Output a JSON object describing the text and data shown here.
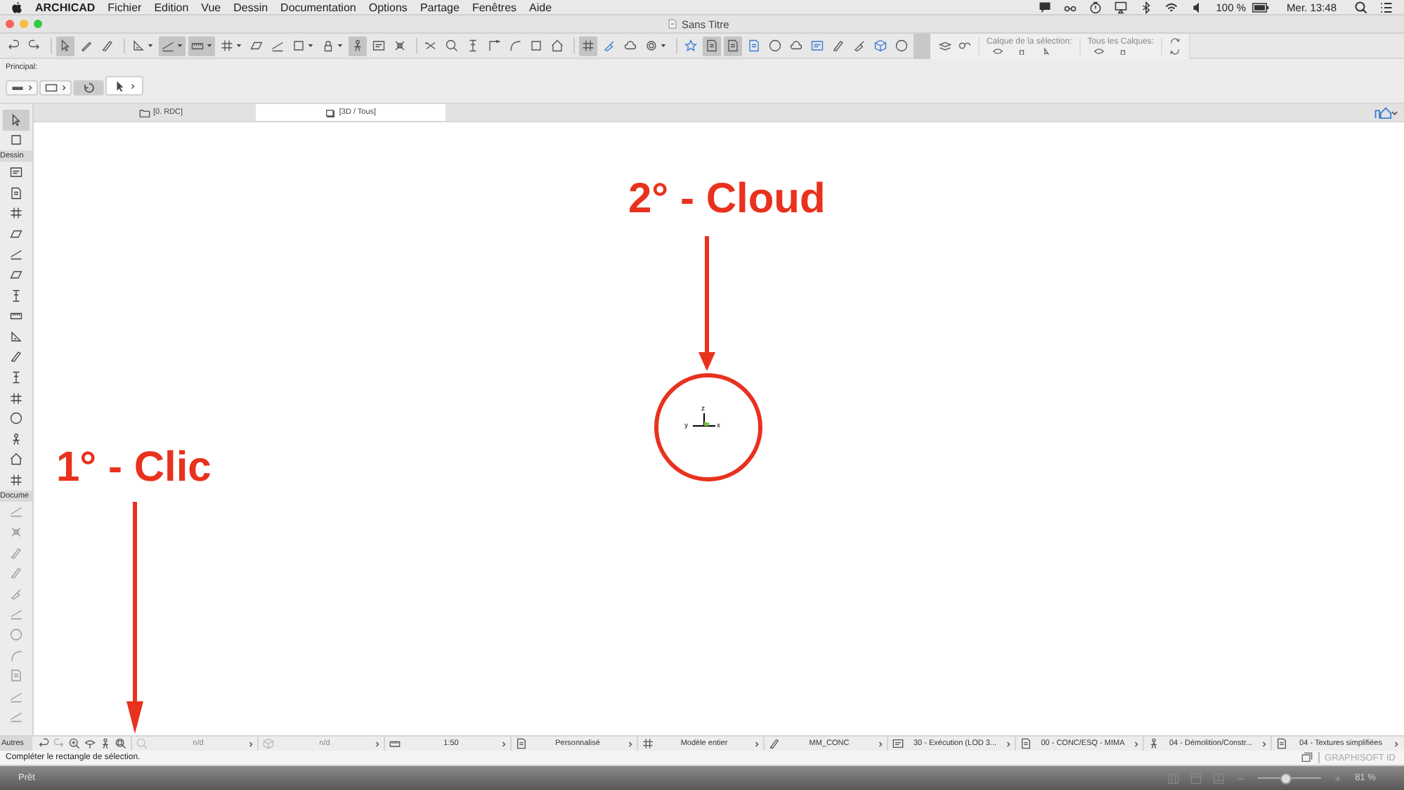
{
  "menu_bar": {
    "app": "ARCHICAD",
    "items": [
      "Fichier",
      "Edition",
      "Vue",
      "Dessin",
      "Documentation",
      "Options",
      "Partage",
      "Fenêtres",
      "Aide"
    ],
    "battery": "100 %",
    "clock": "Mer. 13:48"
  },
  "window": {
    "title": "Sans Titre"
  },
  "toolbar": {
    "buttons": [
      {
        "pressed": false,
        "has_menu": false
      },
      {
        "pressed": false,
        "has_menu": false
      },
      {
        "pressed": true,
        "has_menu": false
      },
      {
        "pressed": false,
        "has_menu": false
      },
      {
        "pressed": false,
        "has_menu": false
      },
      {
        "pressed": false,
        "has_menu": true
      },
      {
        "pressed": true,
        "has_menu": true
      },
      {
        "pressed": true,
        "has_menu": true
      },
      {
        "pressed": false,
        "has_menu": true
      },
      {
        "pressed": false,
        "has_menu": false
      },
      {
        "pressed": false,
        "has_menu": false
      },
      {
        "pressed": false,
        "has_menu": true
      },
      {
        "pressed": false,
        "has_menu": true
      },
      {
        "pressed": true,
        "has_menu": false
      },
      {
        "pressed": false,
        "has_menu": false
      },
      {
        "pressed": false,
        "has_menu": false
      },
      {
        "pressed": false,
        "has_menu": false
      },
      {
        "pressed": false,
        "has_menu": false
      },
      {
        "pressed": false,
        "has_menu": false
      },
      {
        "pressed": false,
        "has_menu": false
      },
      {
        "pressed": false,
        "has_menu": false
      },
      {
        "pressed": false,
        "has_menu": false
      },
      {
        "pressed": false,
        "has_menu": false
      },
      {
        "pressed": true,
        "has_menu": false
      },
      {
        "pressed": false,
        "has_menu": false
      },
      {
        "pressed": false,
        "has_menu": false
      },
      {
        "pressed": false,
        "has_menu": true
      },
      {
        "pressed": false,
        "has_menu": false
      },
      {
        "pressed": true,
        "has_menu": false
      },
      {
        "pressed": true,
        "has_menu": false
      },
      {
        "pressed": false,
        "has_menu": false
      },
      {
        "pressed": false,
        "has_menu": false
      },
      {
        "pressed": false,
        "has_menu": false
      },
      {
        "pressed": false,
        "has_menu": false
      },
      {
        "pressed": false,
        "has_menu": false
      },
      {
        "pressed": false,
        "has_menu": false
      },
      {
        "pressed": false,
        "has_menu": false
      },
      {
        "pressed": false,
        "has_menu": false
      }
    ],
    "layer_selection_label": "Calque de la sélection:",
    "all_layers_label": "Tous les Calques:"
  },
  "info_box": {
    "label": "Principal:"
  },
  "tabs": [
    {
      "label": "[0. RDC]",
      "selected": false
    },
    {
      "label": "[3D / Tous]",
      "selected": true
    }
  ],
  "toolbox": {
    "sections": [
      {
        "tools": [
          {
            "selected": true
          },
          {
            "selected": false
          }
        ]
      },
      {
        "title": "Dessin",
        "tools": [
          {
            "selected": false
          },
          {
            "selected": false
          },
          {
            "selected": false
          },
          {
            "selected": false
          },
          {
            "selected": false
          },
          {
            "selected": false
          },
          {
            "selected": false
          },
          {
            "selected": false
          },
          {
            "selected": false
          },
          {
            "selected": false
          },
          {
            "selected": false
          },
          {
            "selected": false
          },
          {
            "selected": false
          },
          {
            "selected": false
          },
          {
            "selected": false
          },
          {
            "selected": false
          }
        ]
      },
      {
        "title": "Docume",
        "tools": [
          {
            "selected": false
          },
          {
            "selected": false
          },
          {
            "selected": false
          },
          {
            "selected": false
          },
          {
            "selected": false
          },
          {
            "selected": false
          },
          {
            "selected": false
          },
          {
            "selected": false
          },
          {
            "selected": false
          },
          {
            "selected": false
          },
          {
            "selected": false
          }
        ]
      }
    ],
    "footer_title": "Autres"
  },
  "axes": {
    "z": "z",
    "y": "y",
    "x": "x"
  },
  "annotations": [
    {
      "kind": "arrow_down",
      "text": "2° - Cloud"
    },
    {
      "kind": "circle"
    },
    {
      "kind": "arrow_down",
      "text": "1° - Clic"
    }
  ],
  "status_bar": {
    "cells": [
      "n/d",
      "n/d",
      "1:50",
      "Personnalisé",
      "Modèle entier",
      "MM_CONC",
      "30 - Exécution (LOD 3...",
      "00 - CONC/ESQ - MIMA",
      "04 - Démolition/Constr...",
      "04 - Textures simplifiées"
    ],
    "message": "Compléter le rectangle de sélection.",
    "account": "GRAPHISOFT ID"
  },
  "footer": {
    "status": "Prêt",
    "zoom_slider": {
      "level": 0.45
    },
    "zoom": "81 %"
  }
}
